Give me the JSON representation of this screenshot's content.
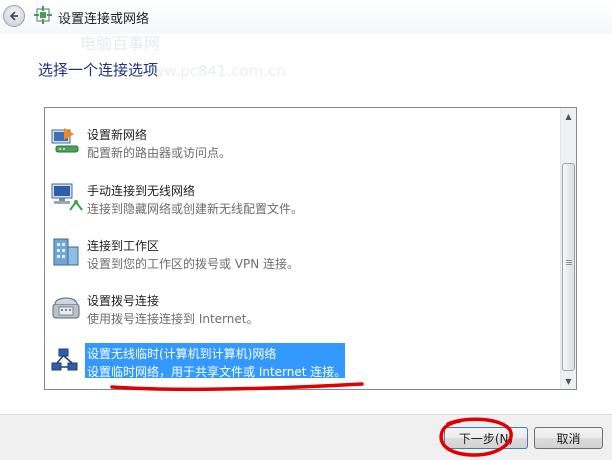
{
  "window": {
    "title": "设置连接或网络"
  },
  "heading": "选择一个连接选项",
  "options": [
    {
      "title": "设置新网络",
      "description": "配置新的路由器或访问点。",
      "icon": "router-network-icon"
    },
    {
      "title": "手动连接到无线网络",
      "description": "连接到隐藏网络或创建新无线配置文件。",
      "icon": "wireless-network-icon"
    },
    {
      "title": "连接到工作区",
      "description": "设置到您的工作区的拨号或 VPN 连接。",
      "icon": "workplace-building-icon"
    },
    {
      "title": "设置拨号连接",
      "description": "使用拨号连接连接到 Internet。",
      "icon": "dialup-phone-icon"
    },
    {
      "title": "设置无线临时(计算机到计算机)网络",
      "description": "设置临时网络，用于共享文件或 Internet 连接。",
      "icon": "adhoc-network-icon",
      "selected": true
    }
  ],
  "buttons": {
    "next": "下一步(N)",
    "cancel": "取消"
  },
  "watermark": {
    "line1": "电脑百事网",
    "line2": "www.pc841.com.cn"
  },
  "colors": {
    "selection": "#3399ff",
    "heading": "#1e3287",
    "annotation": "#e00000"
  }
}
